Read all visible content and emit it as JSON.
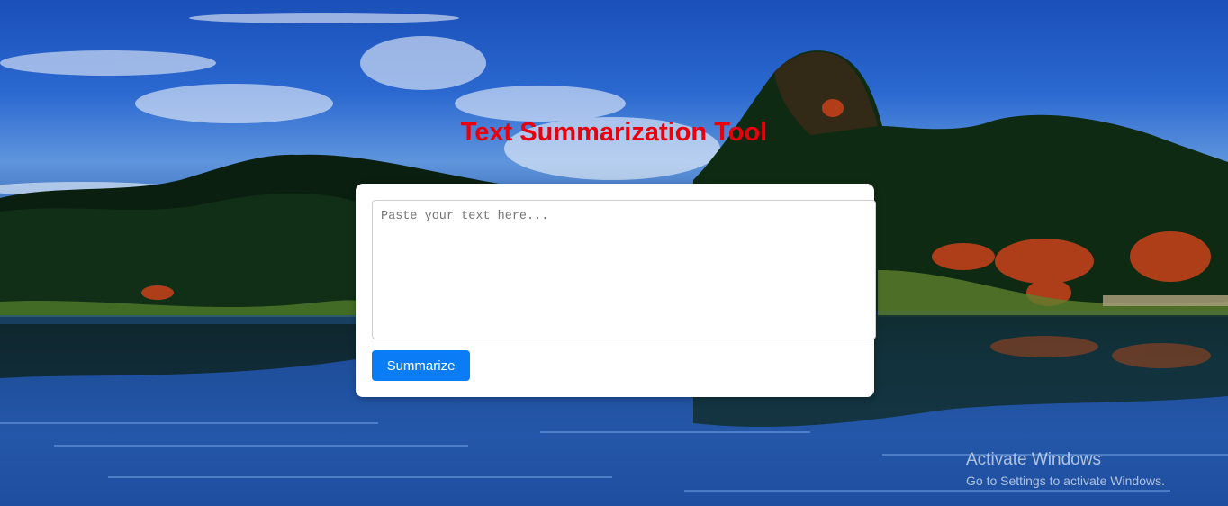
{
  "page": {
    "title": "Text Summarization Tool"
  },
  "editor": {
    "placeholder": "Paste your text here...",
    "value": ""
  },
  "actions": {
    "summarize_label": "Summarize"
  },
  "watermark": {
    "title": "Activate Windows",
    "subtitle": "Go to Settings to activate Windows."
  },
  "colors": {
    "title": "#e8000c",
    "button": "#0a7cf5",
    "card": "#ffffff"
  }
}
